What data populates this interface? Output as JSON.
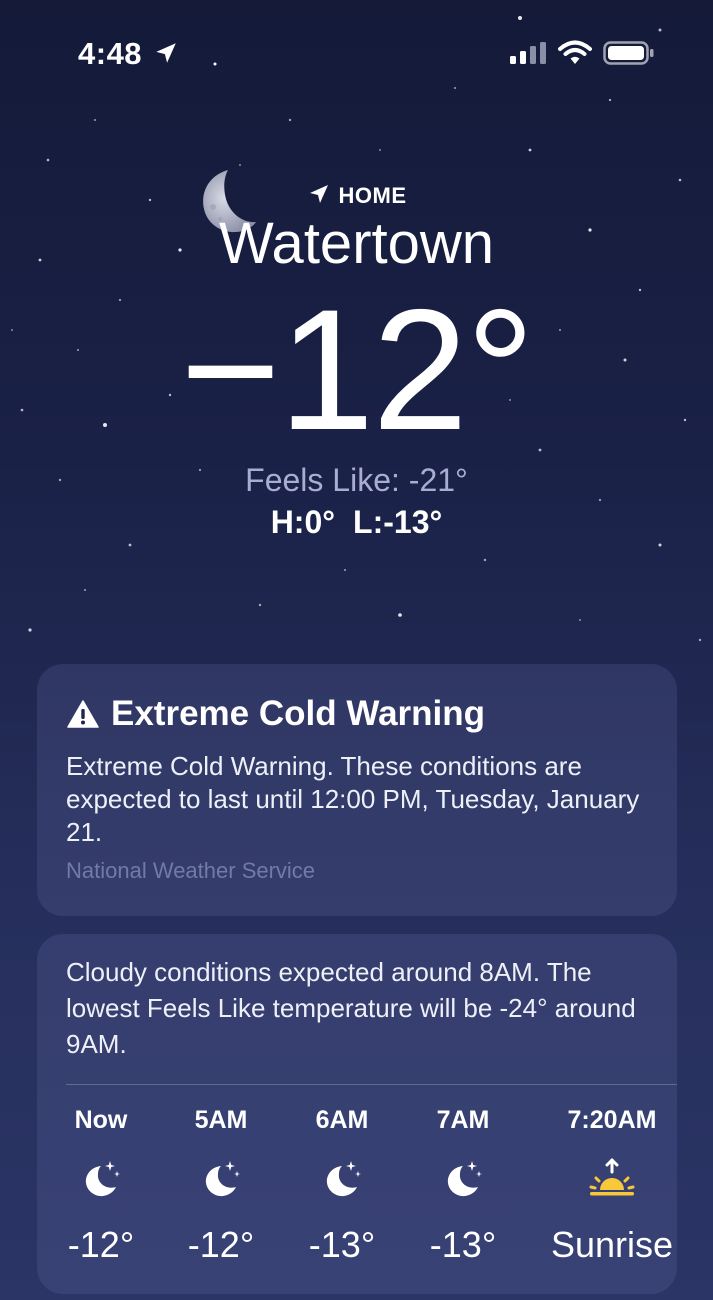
{
  "status_bar": {
    "time": "4:48"
  },
  "header": {
    "home_label": "HOME",
    "city": "Watertown",
    "temperature": "−12°",
    "feels_like": "Feels Like: -21°",
    "high": "H:0°",
    "low": "L:-13°"
  },
  "alert": {
    "title": "Extreme Cold Warning",
    "body": "Extreme Cold Warning. These conditions are expected to last until 12:00 PM, Tuesday, January 21.",
    "source": "National Weather Service"
  },
  "forecast": {
    "summary": "Cloudy conditions expected around 8AM. The lowest Feels Like temperature will be -24° around 9AM.",
    "hours": [
      {
        "label": "Now",
        "icon": "moon-stars-icon",
        "value": "-12°"
      },
      {
        "label": "5AM",
        "icon": "moon-stars-icon",
        "value": "-12°"
      },
      {
        "label": "6AM",
        "icon": "moon-stars-icon",
        "value": "-13°"
      },
      {
        "label": "7AM",
        "icon": "moon-stars-icon",
        "value": "-13°"
      },
      {
        "label": "7:20AM",
        "icon": "sunrise-icon",
        "value": "Sunrise"
      }
    ]
  },
  "colors": {
    "background_top": "#141a38",
    "background_bottom": "#2b3566",
    "sunrise_accent": "#f7c93a",
    "muted_text": "#a9aed1"
  }
}
